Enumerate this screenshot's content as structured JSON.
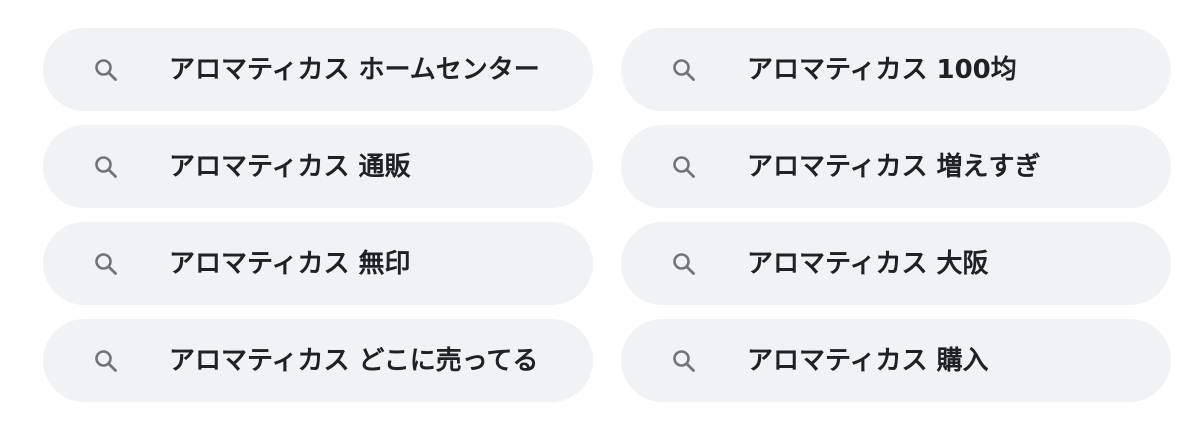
{
  "icons": {
    "search": "search-icon"
  },
  "colors": {
    "chip_background": "#f1f2f5",
    "text": "#202124",
    "icon": "#70757a"
  },
  "suggestions": [
    {
      "label": "アロマティカス ホームセンター"
    },
    {
      "label": "アロマティカス 100均"
    },
    {
      "label": "アロマティカス 通販"
    },
    {
      "label": "アロマティカス 増えすぎ"
    },
    {
      "label": "アロマティカス 無印"
    },
    {
      "label": "アロマティカス 大阪"
    },
    {
      "label": "アロマティカス どこに売ってる"
    },
    {
      "label": "アロマティカス 購入"
    }
  ]
}
